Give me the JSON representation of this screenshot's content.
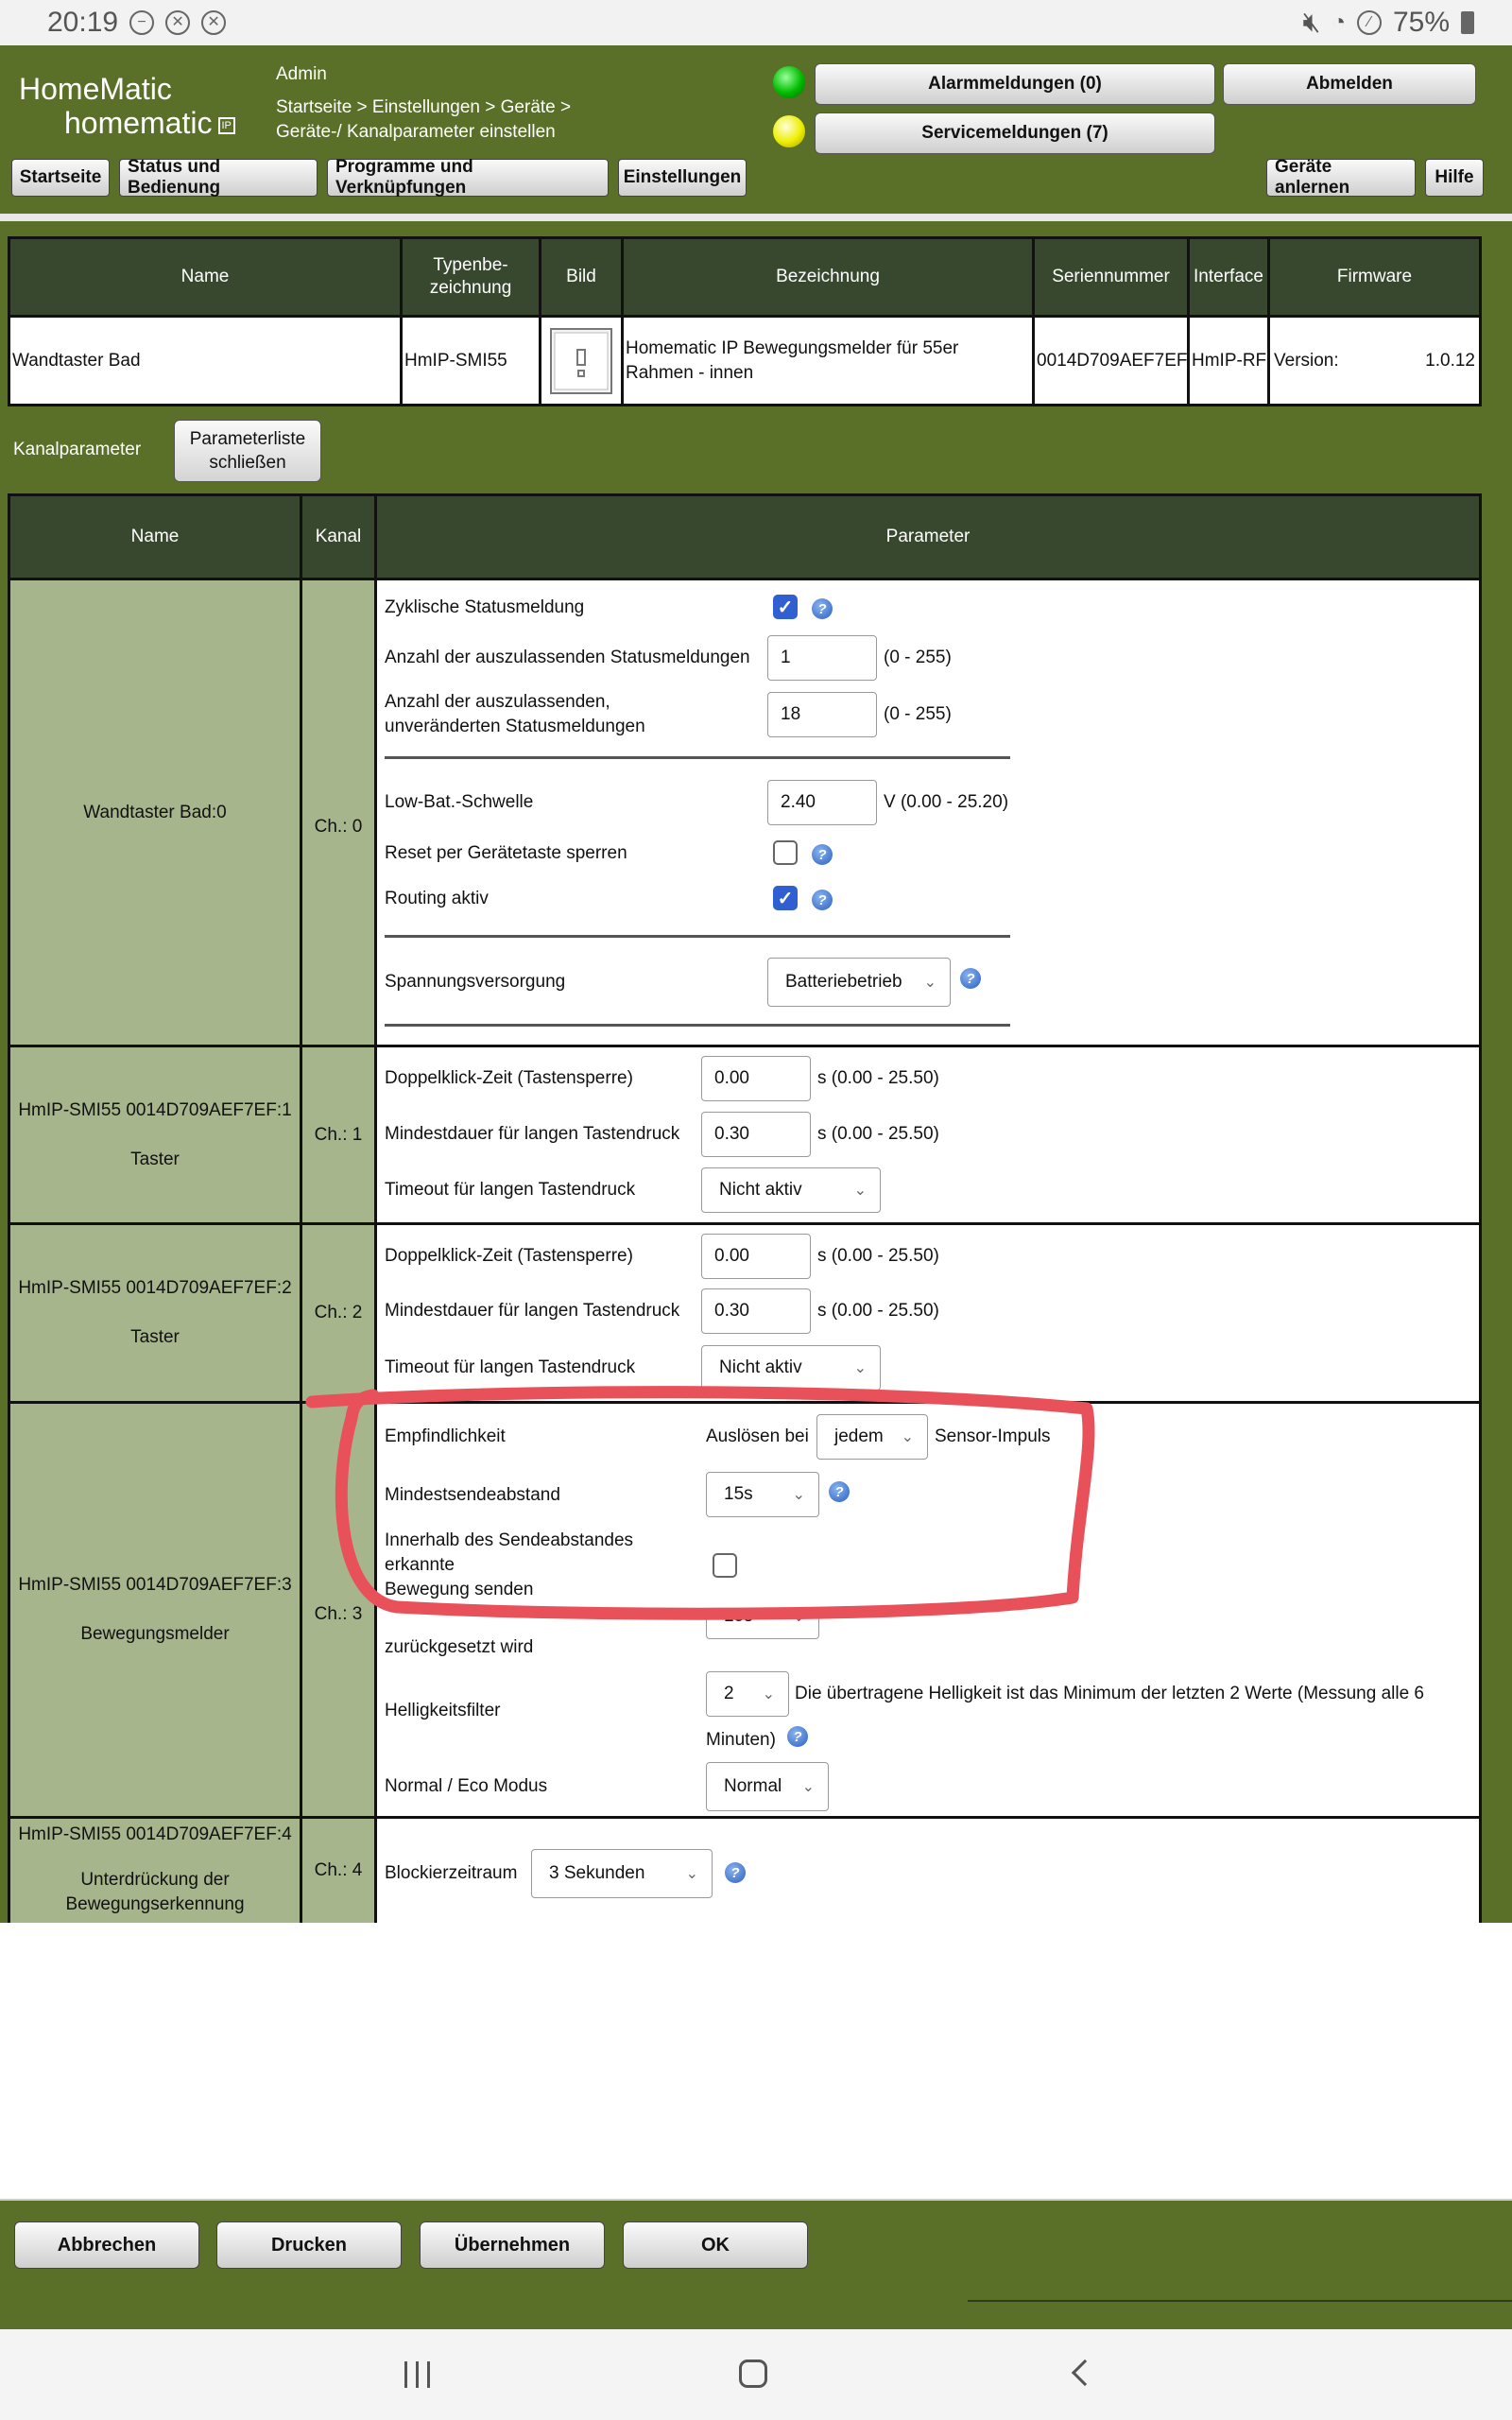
{
  "status_bar": {
    "time": "20:19",
    "battery": "75%"
  },
  "header": {
    "logo_top": "HomeMatic",
    "logo_bottom": "homematic",
    "logo_badge": "IP",
    "user": "Admin",
    "breadcrumb_line1": "Startseite > Einstellungen > Geräte >",
    "breadcrumb_line2": "Geräte-/ Kanalparameter einstellen",
    "alarm_button": "Alarmmeldungen (0)",
    "service_button": "Servicemeldungen (7)",
    "logout_button": "Abmelden"
  },
  "nav": {
    "items": [
      "Startseite",
      "Status und Bedienung",
      "Programme und Verknüpfungen",
      "Einstellungen"
    ],
    "teach_in": "Geräte anlernen",
    "help": "Hilfe"
  },
  "device_table": {
    "headers": {
      "name": "Name",
      "type_line1": "Typenbe-",
      "type_line2": "zeichnung",
      "image": "Bild",
      "description": "Bezeichnung",
      "serial": "Seriennummer",
      "interface": "Interface",
      "firmware": "Firmware"
    },
    "row": {
      "name": "Wandtaster Bad",
      "type": "HmIP-SMI55",
      "description_line1": "Homematic IP Bewegungsmelder für 55er",
      "description_line2": "Rahmen - innen",
      "serial": "0014D709AEF7EF",
      "interface": "HmIP-RF",
      "firmware_label": "Version:",
      "firmware_value": "1.0.12"
    }
  },
  "kanalparameter": {
    "label": "Kanalparameter",
    "button_line1": "Parameterliste",
    "button_line2": "schließen"
  },
  "channel_table": {
    "headers": {
      "name": "Name",
      "channel": "Kanal",
      "parameter": "Parameter"
    }
  },
  "ch0": {
    "name": "Wandtaster Bad:0",
    "channel": "Ch.: 0",
    "cyclic_label": "Zyklische Statusmeldung",
    "cyclic_checked": true,
    "skip_label": "Anzahl der auszulassenden Statusmeldungen",
    "skip_value": "1",
    "skip_range": "(0 - 255)",
    "skip_unchanged_line1": "Anzahl der auszulassenden,",
    "skip_unchanged_line2": "unveränderten Statusmeldungen",
    "skip_unchanged_value": "18",
    "skip_unchanged_range": "(0 - 255)",
    "lowbat_label": "Low-Bat.-Schwelle",
    "lowbat_value": "2.40",
    "lowbat_range": "V (0.00 - 25.20)",
    "reset_label": "Reset per Gerätetaste sperren",
    "reset_checked": false,
    "routing_label": "Routing aktiv",
    "routing_checked": true,
    "power_label": "Spannungsversorgung",
    "power_value": "Batteriebetrieb"
  },
  "ch1": {
    "name": "HmIP-SMI55 0014D709AEF7EF:1",
    "sub": "Taster",
    "channel": "Ch.: 1",
    "dbl_label": "Doppelklick-Zeit (Tastensperre)",
    "dbl_value": "0.00",
    "dbl_range": "s (0.00 - 25.50)",
    "long_label": "Mindestdauer für langen Tastendruck",
    "long_value": "0.30",
    "long_range": "s (0.00 - 25.50)",
    "timeout_label": "Timeout für langen Tastendruck",
    "timeout_value": "Nicht aktiv"
  },
  "ch2": {
    "name": "HmIP-SMI55 0014D709AEF7EF:2",
    "sub": "Taster",
    "channel": "Ch.: 2",
    "dbl_label": "Doppelklick-Zeit (Tastensperre)",
    "dbl_value": "0.00",
    "dbl_range": "s (0.00 - 25.50)",
    "long_label": "Mindestdauer für langen Tastendruck",
    "long_value": "0.30",
    "long_range": "s (0.00 - 25.50)",
    "timeout_label": "Timeout für langen Tastendruck",
    "timeout_value": "Nicht aktiv"
  },
  "ch3": {
    "name": "HmIP-SMI55 0014D709AEF7EF:3",
    "sub": "Bewegungsmelder",
    "channel": "Ch.: 3",
    "sens_label": "Empfindlichkeit",
    "trigger_prefix": "Auslösen bei",
    "trigger_value": "jedem",
    "trigger_suffix": "Sensor-Impuls",
    "interval_label": "Mindestsendeabstand",
    "interval_value": "15s",
    "within_line1": "Innerhalb des Sendeabstandes",
    "within_line2": "erkannte",
    "within_line3": "Bewegung senden",
    "within_checked": false,
    "reset_line2": "zurückgesetzt wird",
    "reset_value": "15s",
    "bright_label": "Helligkeitsfilter",
    "bright_value": "2",
    "bright_text": "Die übertragene Helligkeit ist das Minimum der letzten 2 Werte (Messung alle 6",
    "bright_text2": "Minuten)",
    "eco_label": "Normal / Eco Modus",
    "eco_value": "Normal"
  },
  "ch4": {
    "name": "HmIP-SMI55 0014D709AEF7EF:4",
    "sub_line1": "Unterdrückung der",
    "sub_line2": "Bewegungserkennung",
    "channel": "Ch.: 4",
    "block_label": "Blockierzeitraum",
    "block_value": "3 Sekunden"
  },
  "footer": {
    "cancel": "Abbrechen",
    "print": "Drucken",
    "apply": "Übernehmen",
    "ok": "OK"
  },
  "colors": {
    "green": "#5a7028",
    "header_dark": "#38482f",
    "cell_olive": "#a7b58c",
    "annotation_red": "#e8505a"
  }
}
